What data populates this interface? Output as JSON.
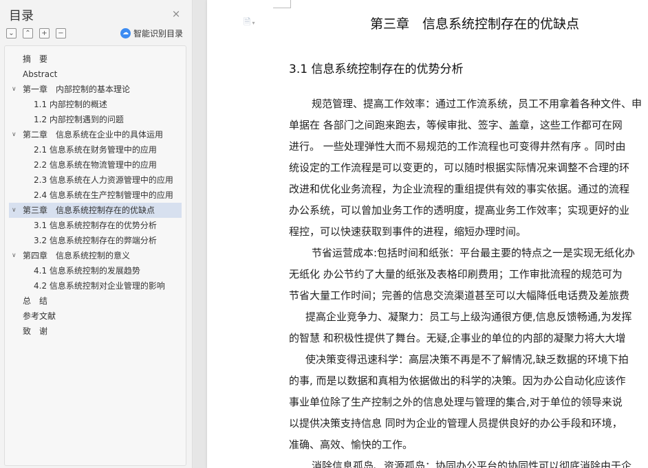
{
  "nav": {
    "title": "目录",
    "close_icon": "×",
    "tools": [
      "⌄",
      "⌃",
      "+",
      "−"
    ],
    "smart_label": "智能识别目录",
    "items": [
      {
        "label": "摘　要",
        "level": 1,
        "chevron": ""
      },
      {
        "label": "Abstract",
        "level": 1,
        "chevron": ""
      },
      {
        "label": "第一章　内部控制的基本理论",
        "level": 1,
        "chevron": "∨"
      },
      {
        "label": "1.1  内部控制的概述",
        "level": 2,
        "chevron": ""
      },
      {
        "label": "1.2  内部控制遇到的问题",
        "level": 2,
        "chevron": ""
      },
      {
        "label": "第二章　信息系统在企业中的具体运用",
        "level": 1,
        "chevron": "∨"
      },
      {
        "label": "2.1  信息系统在财务管理中的应用",
        "level": 2,
        "chevron": ""
      },
      {
        "label": "2.2  信息系统在物流管理中的应用",
        "level": 2,
        "chevron": ""
      },
      {
        "label": "2.3  信息系统在人力资源管理中的应用",
        "level": 2,
        "chevron": ""
      },
      {
        "label": "2.4  信息系统在生产控制管理中的应用",
        "level": 2,
        "chevron": ""
      },
      {
        "label": "第三章　信息系统控制存在的优缺点",
        "level": 1,
        "chevron": "∨",
        "active": true
      },
      {
        "label": "3.1  信息系统控制存在的优势分析",
        "level": 2,
        "chevron": ""
      },
      {
        "label": "3.2  信息系统控制存在的弊端分析",
        "level": 2,
        "chevron": ""
      },
      {
        "label": "第四章　信息系统控制的意义",
        "level": 1,
        "chevron": "∨"
      },
      {
        "label": "4.1  信息系统控制的发展趋势",
        "level": 2,
        "chevron": ""
      },
      {
        "label": "4.2  信息系统控制对企业管理的影响",
        "level": 2,
        "chevron": ""
      },
      {
        "label": "总　结",
        "level": 1,
        "chevron": ""
      },
      {
        "label": "参考文献",
        "level": 1,
        "chevron": ""
      },
      {
        "label": "致　谢",
        "level": 1,
        "chevron": ""
      }
    ]
  },
  "doc": {
    "chapter_title": "第三章　信息系统控制存在的优缺点",
    "section_title": "3.1  信息系统控制存在的优势分析",
    "lines": [
      {
        "text": "规范管理、提高工作效率：通过工作流系统，员工不用拿着各种文件、申",
        "indent": "indent"
      },
      {
        "text": "单据在 各部门之间跑来跑去，等候审批、签字、盖章，这些工作都可在网",
        "indent": ""
      },
      {
        "text": "进行。 一些处理弹性大而不易规范的工作流程也可变得井然有序 。同时由",
        "indent": ""
      },
      {
        "text": "统设定的工作流程是可以变更的，可以随时根据实际情况来调整不合理的环",
        "indent": ""
      },
      {
        "text": "改进和优化业务流程，为企业流程的重组提供有效的事实依据。通过的流程",
        "indent": ""
      },
      {
        "text": "办公系统，可以曾加业务工作的透明度，提高业务工作效率；实现更好的业",
        "indent": ""
      },
      {
        "text": "程控，可以快速获取到事件的进程，缩短办理时间。",
        "indent": ""
      },
      {
        "text": "节省运营成本:包括时间和纸张：平台最主要的特点之一是实现无纸化办",
        "indent": "indent"
      },
      {
        "text": "无纸化 办公节约了大量的纸张及表格印刷费用；工作审批流程的规范可为",
        "indent": ""
      },
      {
        "text": "节省大量工作时间；完善的信息交流渠道甚至可以大幅降低电话费及差旅费",
        "indent": ""
      },
      {
        "text": "提高企业竞争力、凝聚力：员工与上级沟通很方便,信息反馈畅通,为发挥",
        "indent": "indent-s"
      },
      {
        "text": "的智慧 和积极性提供了舞台。无疑,企事业的单位的内部的凝聚力将大大增",
        "indent": ""
      },
      {
        "text": "使决策变得迅速科学：高层决策不再是不了解情况,缺乏数据的环境下拍",
        "indent": "indent-s"
      },
      {
        "text": "的事, 而是以数据和真相为依据做出的科学的决策。因为办公自动化应该作",
        "indent": ""
      },
      {
        "text": "事业单位除了生产控制之外的信息处理与管理的集合,对于单位的领导来说",
        "indent": ""
      },
      {
        "text": "以提供决策支持信息 同时为企业的管理人员提供良好的办公手段和环境，",
        "indent": ""
      },
      {
        "text": "准确、高效、愉快的工作。",
        "indent": ""
      },
      {
        "text": "消除信息孤岛、资源孤岛：协同办公平台的协同性可以彻底消除由于企",
        "indent": "indent"
      }
    ]
  }
}
